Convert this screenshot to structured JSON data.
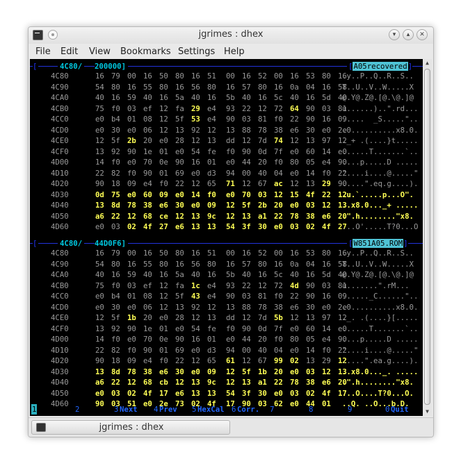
{
  "window": {
    "title": "jgrimes : dhex"
  },
  "menu": [
    "File",
    "Edit",
    "View",
    "Bookmarks",
    "Settings",
    "Help"
  ],
  "panes": [
    {
      "bracket": "[",
      "cursor_addr": "4C80/",
      "size": "200000]",
      "filename": "A05recovered",
      "rows": [
        {
          "addr": "4C80",
          "hex": [
            "16",
            "79",
            "00",
            "16",
            "50",
            "80",
            "16",
            "51",
            "00",
            "16",
            "52",
            "00",
            "16",
            "53",
            "80",
            "16"
          ],
          "ascii": ".y..P..Q..R..S..",
          "hl": []
        },
        {
          "addr": "4C90",
          "hex": [
            "54",
            "80",
            "16",
            "55",
            "80",
            "16",
            "56",
            "80",
            "16",
            "57",
            "80",
            "16",
            "0a",
            "04",
            "16",
            "58"
          ],
          "ascii": "T..U..V..W.....X",
          "hl": []
        },
        {
          "addr": "4CA0",
          "hex": [
            "40",
            "16",
            "59",
            "40",
            "16",
            "5a",
            "40",
            "16",
            "5b",
            "40",
            "16",
            "5c",
            "40",
            "16",
            "5d",
            "40"
          ],
          "ascii": "@.Y@.Z@.[@.\\@.]@",
          "hl": []
        },
        {
          "addr": "4CB0",
          "hex": [
            "75",
            "f0",
            "03",
            "ef",
            "12",
            "fa",
            "29",
            "e4",
            "93",
            "22",
            "12",
            "72",
            "64",
            "90",
            "03",
            "81"
          ],
          "ascii": "u......)..\".rd...",
          "hl": [
            6,
            12
          ]
        },
        {
          "addr": "4CC0",
          "hex": [
            "e0",
            "b4",
            "01",
            "08",
            "12",
            "5f",
            "53",
            "e4",
            "90",
            "03",
            "81",
            "f0",
            "22",
            "90",
            "16",
            "09"
          ],
          "ascii": ".....  _S.....\"...",
          "hl": [
            6
          ]
        },
        {
          "addr": "4CD0",
          "hex": [
            "e0",
            "30",
            "e0",
            "06",
            "12",
            "13",
            "92",
            "12",
            "13",
            "88",
            "78",
            "38",
            "e6",
            "30",
            "e0",
            "2e"
          ],
          "ascii": ".0..........x8.0..",
          "hl": []
        },
        {
          "addr": "4CE0",
          "hex": [
            "12",
            "5f",
            "2b",
            "20",
            "e0",
            "28",
            "12",
            "13",
            "dd",
            "12",
            "7d",
            "74",
            "12",
            "13",
            "97",
            "12"
          ],
          "ascii": "._+ .(....}t.....",
          "hl": [
            2,
            11
          ]
        },
        {
          "addr": "4CF0",
          "hex": [
            "13",
            "92",
            "90",
            "1e",
            "01",
            "e0",
            "54",
            "fe",
            "f0",
            "90",
            "0d",
            "7f",
            "e0",
            "60",
            "14",
            "e0"
          ],
          "ascii": "......T.......`..",
          "hl": []
        },
        {
          "addr": "4D00",
          "hex": [
            "14",
            "f0",
            "e0",
            "70",
            "0e",
            "90",
            "16",
            "01",
            "e0",
            "44",
            "20",
            "f0",
            "80",
            "05",
            "e4",
            "90"
          ],
          "ascii": "....p.....D .....",
          "hl": []
        },
        {
          "addr": "4D10",
          "hex": [
            "22",
            "82",
            "f0",
            "90",
            "01",
            "69",
            "e0",
            "d3",
            "94",
            "00",
            "40",
            "04",
            "e0",
            "14",
            "f0",
            "22"
          ],
          "ascii": "\"....i....@.....\"",
          "hl": []
        },
        {
          "addr": "4D20",
          "hex": [
            "90",
            "18",
            "09",
            "e4",
            "f0",
            "22",
            "12",
            "65",
            "71",
            "12",
            "67",
            "ac",
            "12",
            "13",
            "29",
            "90"
          ],
          "ascii": ".....\".eq.g....).",
          "hl": [
            8,
            11,
            14
          ]
        },
        {
          "addr": "4D30",
          "hex": [
            "0d",
            "75",
            "e0",
            "60",
            "09",
            "e0",
            "14",
            "f0",
            "e0",
            "70",
            "03",
            "12",
            "15",
            "4f",
            "22",
            "12"
          ],
          "ascii": ".u.`.....p...O\".",
          "hl": "all"
        },
        {
          "addr": "4D40",
          "hex": [
            "13",
            "8d",
            "78",
            "38",
            "e6",
            "30",
            "e0",
            "09",
            "12",
            "5f",
            "2b",
            "20",
            "e0",
            "03",
            "12",
            "13"
          ],
          "ascii": "..x8.0..._+ .....",
          "hl": "all"
        },
        {
          "addr": "4D50",
          "hex": [
            "a6",
            "22",
            "12",
            "68",
            "ce",
            "12",
            "13",
            "9c",
            "12",
            "13",
            "a1",
            "22",
            "78",
            "38",
            "e6",
            "20"
          ],
          "ascii": ".\".h........\"x8.",
          "hl": "all"
        },
        {
          "addr": "4D60",
          "hex": [
            "e0",
            "03",
            "02",
            "4f",
            "27",
            "e6",
            "13",
            "13",
            "54",
            "3f",
            "30",
            "e0",
            "03",
            "02",
            "4f",
            "27"
          ],
          "ascii": "...O'.....T?0...O'",
          "hl": [
            2,
            3,
            4,
            5,
            6,
            7,
            8,
            9,
            10,
            11,
            12,
            13,
            14,
            15
          ]
        }
      ]
    },
    {
      "bracket": "[",
      "cursor_addr": "4C80/",
      "size": "44D0F6]",
      "filename": "W851A05.ROM",
      "rows": [
        {
          "addr": "4C80",
          "hex": [
            "16",
            "79",
            "00",
            "16",
            "50",
            "80",
            "16",
            "51",
            "00",
            "16",
            "52",
            "00",
            "16",
            "53",
            "80",
            "16"
          ],
          "ascii": ".y..P..Q..R..S..",
          "hl": []
        },
        {
          "addr": "4C90",
          "hex": [
            "54",
            "80",
            "16",
            "55",
            "80",
            "16",
            "56",
            "80",
            "16",
            "57",
            "80",
            "16",
            "0a",
            "04",
            "16",
            "58"
          ],
          "ascii": "T..U..V..W.....X",
          "hl": []
        },
        {
          "addr": "4CA0",
          "hex": [
            "40",
            "16",
            "59",
            "40",
            "16",
            "5a",
            "40",
            "16",
            "5b",
            "40",
            "16",
            "5c",
            "40",
            "16",
            "5d",
            "40"
          ],
          "ascii": "@.Y@.Z@.[@.\\@.]@",
          "hl": []
        },
        {
          "addr": "4CB0",
          "hex": [
            "75",
            "f0",
            "03",
            "ef",
            "12",
            "fa",
            "1c",
            "e4",
            "93",
            "22",
            "12",
            "72",
            "4d",
            "90",
            "03",
            "81"
          ],
          "ascii": "u.......\".rM...",
          "hl": [
            6,
            12
          ]
        },
        {
          "addr": "4CC0",
          "hex": [
            "e0",
            "b4",
            "01",
            "08",
            "12",
            "5f",
            "43",
            "e4",
            "90",
            "03",
            "81",
            "f0",
            "22",
            "90",
            "16",
            "09"
          ],
          "ascii": "......_C......\"...",
          "hl": [
            6
          ]
        },
        {
          "addr": "4CD0",
          "hex": [
            "e0",
            "30",
            "e0",
            "06",
            "12",
            "13",
            "92",
            "12",
            "13",
            "88",
            "78",
            "38",
            "e6",
            "30",
            "e0",
            "2e"
          ],
          "ascii": ".0..........x8.0..",
          "hl": []
        },
        {
          "addr": "4CE0",
          "hex": [
            "12",
            "5f",
            "1b",
            "20",
            "e0",
            "28",
            "12",
            "13",
            "dd",
            "12",
            "7d",
            "5b",
            "12",
            "13",
            "97",
            "12"
          ],
          "ascii": "._. .(....}[.....",
          "hl": [
            2,
            11
          ]
        },
        {
          "addr": "4CF0",
          "hex": [
            "13",
            "92",
            "90",
            "1e",
            "01",
            "e0",
            "54",
            "fe",
            "f0",
            "90",
            "0d",
            "7f",
            "e0",
            "60",
            "14",
            "e0"
          ],
          "ascii": "......T.......`..",
          "hl": []
        },
        {
          "addr": "4D00",
          "hex": [
            "14",
            "f0",
            "e0",
            "70",
            "0e",
            "90",
            "16",
            "01",
            "e0",
            "44",
            "20",
            "f0",
            "80",
            "05",
            "e4",
            "90"
          ],
          "ascii": "....p.....D .....",
          "hl": []
        },
        {
          "addr": "4D10",
          "hex": [
            "22",
            "82",
            "f0",
            "90",
            "01",
            "69",
            "e0",
            "d3",
            "94",
            "00",
            "40",
            "04",
            "e0",
            "14",
            "f0",
            "22"
          ],
          "ascii": "\"....i....@.....\"",
          "hl": []
        },
        {
          "addr": "4D20",
          "hex": [
            "90",
            "18",
            "09",
            "e4",
            "f0",
            "22",
            "12",
            "65",
            "61",
            "12",
            "67",
            "99",
            "02",
            "13",
            "29",
            "12"
          ],
          "ascii": ".....\".ea.g....).",
          "hl": [
            8,
            11,
            12,
            15
          ]
        },
        {
          "addr": "4D30",
          "hex": [
            "13",
            "8d",
            "78",
            "38",
            "e6",
            "30",
            "e0",
            "09",
            "12",
            "5f",
            "1b",
            "20",
            "e0",
            "03",
            "12",
            "13"
          ],
          "ascii": "..x8.0..._. .....",
          "hl": "all"
        },
        {
          "addr": "4D40",
          "hex": [
            "a6",
            "22",
            "12",
            "68",
            "cb",
            "12",
            "13",
            "9c",
            "12",
            "13",
            "a1",
            "22",
            "78",
            "38",
            "e6",
            "20"
          ],
          "ascii": ".\".h........\"x8.",
          "hl": "all"
        },
        {
          "addr": "4D50",
          "hex": [
            "e0",
            "03",
            "02",
            "4f",
            "17",
            "e6",
            "13",
            "13",
            "54",
            "3f",
            "30",
            "e0",
            "03",
            "02",
            "4f",
            "17"
          ],
          "ascii": "...O....T?0...O.",
          "hl": "all"
        },
        {
          "addr": "4D60",
          "hex": [
            "90",
            "03",
            "51",
            "e0",
            "2e",
            "73",
            "02",
            "4f",
            "17",
            "90",
            "03",
            "62",
            "e0",
            "44",
            "01"
          ],
          "ascii": "..Q. ..O...b.D.",
          "hl": "all"
        }
      ]
    }
  ],
  "fkeys": [
    {
      "num": "1",
      "label": ""
    },
    {
      "num": "2",
      "label": ""
    },
    {
      "num": "3",
      "label": "Next"
    },
    {
      "num": "4",
      "label": "Prev"
    },
    {
      "num": "5",
      "label": "HexCal"
    },
    {
      "num": "6",
      "label": "Corr."
    },
    {
      "num": "7",
      "label": ""
    },
    {
      "num": "8",
      "label": ""
    },
    {
      "num": "9",
      "label": ""
    },
    {
      "num": "0",
      "label": "Quit"
    }
  ],
  "taskbar": {
    "label": "jgrimes : dhex"
  },
  "colors": {
    "accent": "#ffff55",
    "dim": "#9a9a9a",
    "cyan": "#00c8e0",
    "fname_bg": "#4fc3d5",
    "bar": "#2233dd"
  }
}
